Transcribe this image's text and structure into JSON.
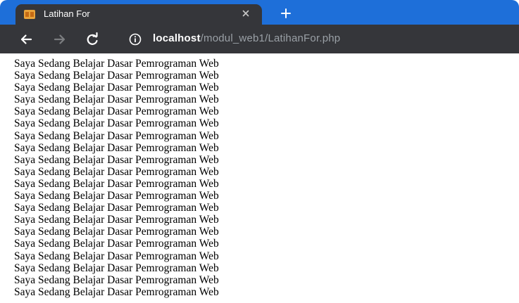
{
  "browser": {
    "tab": {
      "title": "Latihan For"
    },
    "address_bar": {
      "host": "localhost",
      "path": "/modul_web1/LatihanFor.php"
    },
    "colors": {
      "tabstrip": "#1e6fd9",
      "toolbar": "#35363a",
      "favicon": "#e8a33b"
    }
  },
  "page": {
    "lines": [
      "Saya Sedang Belajar Dasar Pemrograman Web",
      "Saya Sedang Belajar Dasar Pemrograman Web",
      "Saya Sedang Belajar Dasar Pemrograman Web",
      "Saya Sedang Belajar Dasar Pemrograman Web",
      "Saya Sedang Belajar Dasar Pemrograman Web",
      "Saya Sedang Belajar Dasar Pemrograman Web",
      "Saya Sedang Belajar Dasar Pemrograman Web",
      "Saya Sedang Belajar Dasar Pemrograman Web",
      "Saya Sedang Belajar Dasar Pemrograman Web",
      "Saya Sedang Belajar Dasar Pemrograman Web",
      "Saya Sedang Belajar Dasar Pemrograman Web",
      "Saya Sedang Belajar Dasar Pemrograman Web",
      "Saya Sedang Belajar Dasar Pemrograman Web",
      "Saya Sedang Belajar Dasar Pemrograman Web",
      "Saya Sedang Belajar Dasar Pemrograman Web",
      "Saya Sedang Belajar Dasar Pemrograman Web",
      "Saya Sedang Belajar Dasar Pemrograman Web",
      "Saya Sedang Belajar Dasar Pemrograman Web",
      "Saya Sedang Belajar Dasar Pemrograman Web",
      "Saya Sedang Belajar Dasar Pemrograman Web"
    ]
  }
}
